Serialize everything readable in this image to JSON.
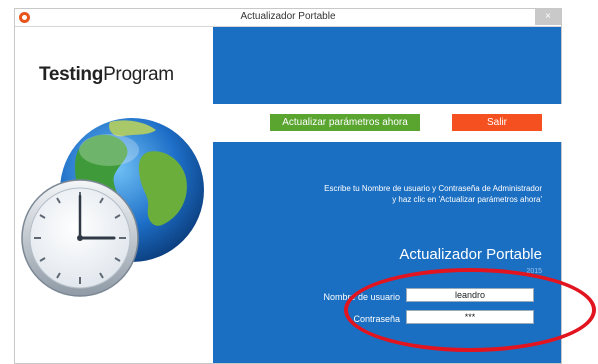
{
  "window": {
    "title": "Actualizador Portable",
    "close_glyph": "×"
  },
  "brand": {
    "bold": "Testing",
    "regular": "Program"
  },
  "actions": {
    "update_label": "Actualizar parámetros ahora",
    "exit_label": "Salir"
  },
  "instructions": {
    "line1": "Escribe tu Nombre de usuario y Contraseña de Administrador",
    "line2": "y haz clic en 'Actualizar parámetros ahora'"
  },
  "panel": {
    "heading": "Actualizador Portable",
    "year": "2015"
  },
  "form": {
    "username_label": "Nombre de usuario",
    "username_value": "leandro",
    "password_label": "Contraseña",
    "password_value": "***"
  },
  "colors": {
    "accent_blue": "#1b6fc2",
    "update_green": "#5aa530",
    "exit_orange": "#f5501f",
    "annotation_red": "#e2141f"
  },
  "icons": {
    "app": "app-icon",
    "illustration": "globe-clock-icon"
  }
}
